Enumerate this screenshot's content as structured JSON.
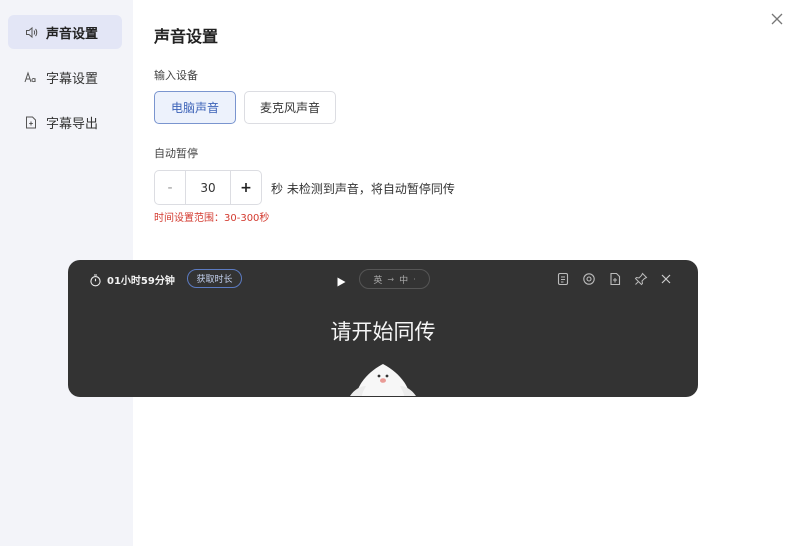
{
  "sidebar": {
    "items": [
      {
        "label": "声音设置",
        "icon": "speaker-icon"
      },
      {
        "label": "字幕设置",
        "icon": "font-size-icon"
      },
      {
        "label": "字幕导出",
        "icon": "file-export-icon"
      }
    ],
    "active_index": 0
  },
  "main": {
    "title": "声音设置",
    "input_device": {
      "label": "输入设备",
      "options": [
        "电脑声音",
        "麦克风声音"
      ],
      "selected": "电脑声音"
    },
    "auto_pause": {
      "label": "自动暂停",
      "minus": "-",
      "value": "30",
      "plus": "+",
      "suffix": "秒 未检测到声音，将自动暂停同传",
      "hint": "时间设置范围：30-300秒"
    }
  },
  "overlay": {
    "timer": "01小时59分钟",
    "get_duration": "获取时长",
    "source_lang": "英",
    "arrow": "→",
    "target_lang": "中",
    "dropdown_dot": "·",
    "message": "请开始同传",
    "icons": [
      "document-icon",
      "settings-icon",
      "export-icon",
      "pin-icon",
      "close-icon"
    ]
  },
  "colors": {
    "sidebar_bg": "#f3f4f9",
    "sidebar_active": "#e3e6f6",
    "accent": "#3d63b8",
    "hint_red": "#d33a2f",
    "overlay_bg": "#333333"
  }
}
